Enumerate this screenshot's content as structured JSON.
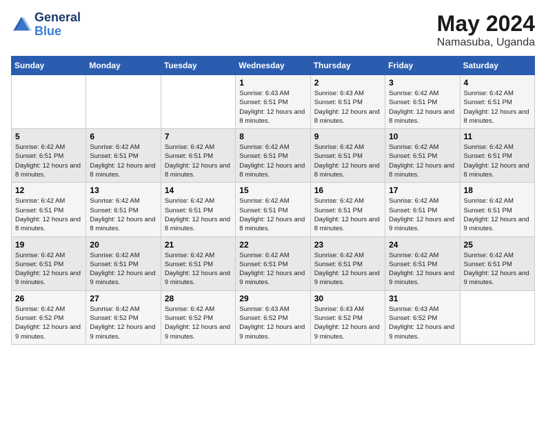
{
  "header": {
    "logo_line1": "General",
    "logo_line2": "Blue",
    "month_title": "May 2024",
    "location": "Namasuba, Uganda"
  },
  "days_of_week": [
    "Sunday",
    "Monday",
    "Tuesday",
    "Wednesday",
    "Thursday",
    "Friday",
    "Saturday"
  ],
  "weeks": [
    [
      {
        "day": null
      },
      {
        "day": null
      },
      {
        "day": null
      },
      {
        "day": "1",
        "sunrise": "6:43 AM",
        "sunset": "6:51 PM",
        "daylight": "12 hours and 8 minutes."
      },
      {
        "day": "2",
        "sunrise": "6:43 AM",
        "sunset": "6:51 PM",
        "daylight": "12 hours and 8 minutes."
      },
      {
        "day": "3",
        "sunrise": "6:42 AM",
        "sunset": "6:51 PM",
        "daylight": "12 hours and 8 minutes."
      },
      {
        "day": "4",
        "sunrise": "6:42 AM",
        "sunset": "6:51 PM",
        "daylight": "12 hours and 8 minutes."
      }
    ],
    [
      {
        "day": "5",
        "sunrise": "6:42 AM",
        "sunset": "6:51 PM",
        "daylight": "12 hours and 8 minutes."
      },
      {
        "day": "6",
        "sunrise": "6:42 AM",
        "sunset": "6:51 PM",
        "daylight": "12 hours and 8 minutes."
      },
      {
        "day": "7",
        "sunrise": "6:42 AM",
        "sunset": "6:51 PM",
        "daylight": "12 hours and 8 minutes."
      },
      {
        "day": "8",
        "sunrise": "6:42 AM",
        "sunset": "6:51 PM",
        "daylight": "12 hours and 8 minutes."
      },
      {
        "day": "9",
        "sunrise": "6:42 AM",
        "sunset": "6:51 PM",
        "daylight": "12 hours and 8 minutes."
      },
      {
        "day": "10",
        "sunrise": "6:42 AM",
        "sunset": "6:51 PM",
        "daylight": "12 hours and 8 minutes."
      },
      {
        "day": "11",
        "sunrise": "6:42 AM",
        "sunset": "6:51 PM",
        "daylight": "12 hours and 8 minutes."
      }
    ],
    [
      {
        "day": "12",
        "sunrise": "6:42 AM",
        "sunset": "6:51 PM",
        "daylight": "12 hours and 8 minutes."
      },
      {
        "day": "13",
        "sunrise": "6:42 AM",
        "sunset": "6:51 PM",
        "daylight": "12 hours and 8 minutes."
      },
      {
        "day": "14",
        "sunrise": "6:42 AM",
        "sunset": "6:51 PM",
        "daylight": "12 hours and 8 minutes."
      },
      {
        "day": "15",
        "sunrise": "6:42 AM",
        "sunset": "6:51 PM",
        "daylight": "12 hours and 8 minutes."
      },
      {
        "day": "16",
        "sunrise": "6:42 AM",
        "sunset": "6:51 PM",
        "daylight": "12 hours and 8 minutes."
      },
      {
        "day": "17",
        "sunrise": "6:42 AM",
        "sunset": "6:51 PM",
        "daylight": "12 hours and 9 minutes."
      },
      {
        "day": "18",
        "sunrise": "6:42 AM",
        "sunset": "6:51 PM",
        "daylight": "12 hours and 9 minutes."
      }
    ],
    [
      {
        "day": "19",
        "sunrise": "6:42 AM",
        "sunset": "6:51 PM",
        "daylight": "12 hours and 9 minutes."
      },
      {
        "day": "20",
        "sunrise": "6:42 AM",
        "sunset": "6:51 PM",
        "daylight": "12 hours and 9 minutes."
      },
      {
        "day": "21",
        "sunrise": "6:42 AM",
        "sunset": "6:51 PM",
        "daylight": "12 hours and 9 minutes."
      },
      {
        "day": "22",
        "sunrise": "6:42 AM",
        "sunset": "6:51 PM",
        "daylight": "12 hours and 9 minutes."
      },
      {
        "day": "23",
        "sunrise": "6:42 AM",
        "sunset": "6:51 PM",
        "daylight": "12 hours and 9 minutes."
      },
      {
        "day": "24",
        "sunrise": "6:42 AM",
        "sunset": "6:51 PM",
        "daylight": "12 hours and 9 minutes."
      },
      {
        "day": "25",
        "sunrise": "6:42 AM",
        "sunset": "6:51 PM",
        "daylight": "12 hours and 9 minutes."
      }
    ],
    [
      {
        "day": "26",
        "sunrise": "6:42 AM",
        "sunset": "6:52 PM",
        "daylight": "12 hours and 9 minutes."
      },
      {
        "day": "27",
        "sunrise": "6:42 AM",
        "sunset": "6:52 PM",
        "daylight": "12 hours and 9 minutes."
      },
      {
        "day": "28",
        "sunrise": "6:42 AM",
        "sunset": "6:52 PM",
        "daylight": "12 hours and 9 minutes."
      },
      {
        "day": "29",
        "sunrise": "6:43 AM",
        "sunset": "6:52 PM",
        "daylight": "12 hours and 9 minutes."
      },
      {
        "day": "30",
        "sunrise": "6:43 AM",
        "sunset": "6:52 PM",
        "daylight": "12 hours and 9 minutes."
      },
      {
        "day": "31",
        "sunrise": "6:43 AM",
        "sunset": "6:52 PM",
        "daylight": "12 hours and 9 minutes."
      },
      {
        "day": null
      }
    ]
  ],
  "labels": {
    "sunrise_prefix": "Sunrise: ",
    "sunset_prefix": "Sunset: ",
    "daylight_prefix": "Daylight: "
  }
}
